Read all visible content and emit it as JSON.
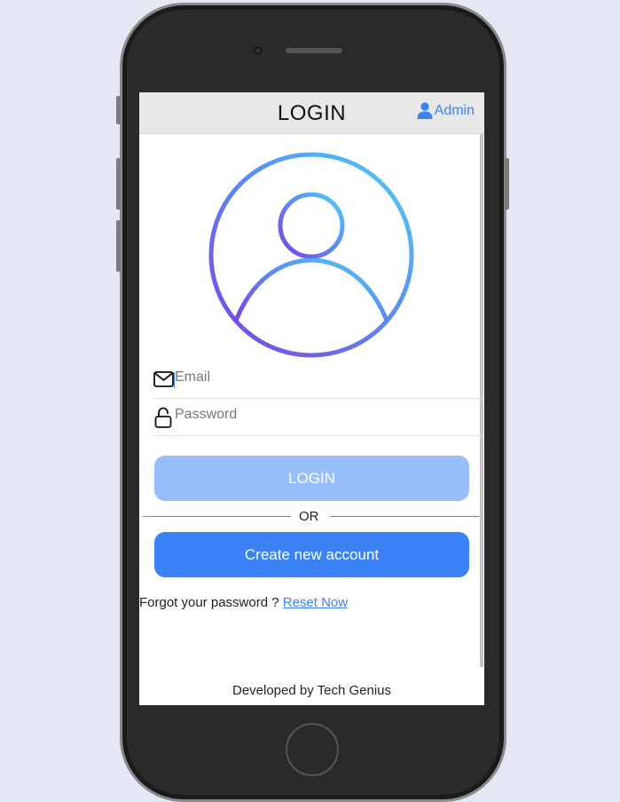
{
  "header": {
    "title": "LOGIN",
    "admin_label": "Admin"
  },
  "form": {
    "email_placeholder": "Email",
    "password_placeholder": "Password",
    "login_label": "LOGIN",
    "or_label": "OR",
    "create_account_label": "Create new account"
  },
  "forgot": {
    "text": "Forgot your password ?",
    "link_label": "Reset Now"
  },
  "footer": {
    "text": "Developed by Tech Genius"
  },
  "colors": {
    "accent": "#3b82f6",
    "login_button_disabled": "#98bff9",
    "avatar_gradient_start": "#7b3fe4",
    "avatar_gradient_end": "#4fc8f5",
    "page_background": "#e5e8f4"
  },
  "icons": {
    "admin": "user-icon",
    "avatar": "user-circle-icon",
    "email": "envelope-icon",
    "password": "lock-icon"
  }
}
